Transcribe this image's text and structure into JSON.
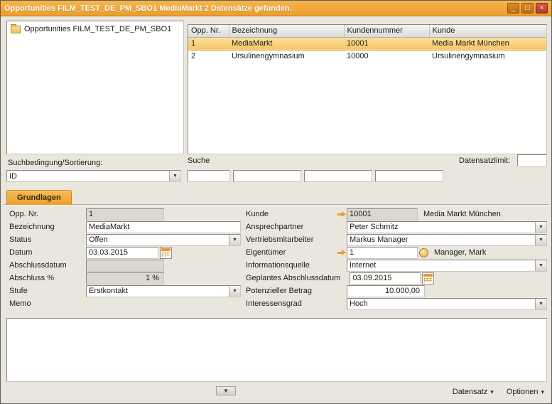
{
  "window": {
    "title": "Opportunities FILM_TEST_DE_PM_SBO1 MediaMarkt 2 Datensätze gefunden.",
    "controls": {
      "minimize": "_",
      "maximize": "□",
      "close": "×"
    }
  },
  "glyphs": {
    "combo_arrow": "▼",
    "chevron_down": "▾",
    "collapse_arrow": "▼"
  },
  "tree": {
    "root_label": "Opportunities FILM_TEST_DE_PM_SBO1"
  },
  "results_table": {
    "columns": [
      "Opp. Nr.",
      "Bezeichnung",
      "Kundennummer",
      "Kunde"
    ],
    "rows": [
      {
        "opp_nr": "1",
        "bezeichnung": "MediaMarkt",
        "kundennummer": "10001",
        "kunde": "Media Markt München"
      },
      {
        "opp_nr": "2",
        "bezeichnung": "Ursulinengymnasium",
        "kundennummer": "10000",
        "kunde": "Ursulinengymnasium"
      }
    ]
  },
  "search": {
    "sort_label": "Suchbedingung/Sortierung:",
    "sort_value": "ID",
    "search_label": "Suche",
    "limit_label": "Datensatzlimit:",
    "limit_value": "",
    "fields": [
      "",
      "",
      "",
      ""
    ]
  },
  "tab": {
    "label": "Grundlagen"
  },
  "form": {
    "opp_nr": {
      "label": "Opp. Nr.",
      "value": "1"
    },
    "bezeichnung": {
      "label": "Bezeichnung",
      "value": "MediaMarkt"
    },
    "status": {
      "label": "Status",
      "value": "Offen"
    },
    "datum": {
      "label": "Datum",
      "value": "03.03.2015"
    },
    "abschlussdatum": {
      "label": "Abschlussdatum",
      "value": ""
    },
    "abschluss_prozent": {
      "label": "Abschluss %",
      "value": "1 %"
    },
    "stufe": {
      "label": "Stufe",
      "value": "Erstkontakt"
    },
    "memo": {
      "label": "Memo",
      "value": ""
    },
    "kunde": {
      "label": "Kunde",
      "value": "10001",
      "text": "Media Markt München"
    },
    "ansprechpartner": {
      "label": "Ansprechpartner",
      "value": "Peter Schmitz"
    },
    "vertriebsmitarbeiter": {
      "label": "Vertriebsmitarbeiter",
      "value": "Markus Manager"
    },
    "eigentuemer": {
      "label": "Eigentümer",
      "value": "1",
      "text": "Manager, Mark"
    },
    "informationsquelle": {
      "label": "Informationsquelle",
      "value": "Internet"
    },
    "geplantes_abschlussdatum": {
      "label": "Geplantes Abschlussdatum",
      "value": "03.09.2015"
    },
    "potenzieller_betrag": {
      "label": "Potenzieller Betrag",
      "value": "10.000,00"
    },
    "interessensgrad": {
      "label": "Interessensgrad",
      "value": "Hoch"
    }
  },
  "footer": {
    "datensatz_label": "Datensatz",
    "optionen_label": "Optionen"
  },
  "colors": {
    "titlebar": "#f0a232",
    "selection": "#fad184",
    "tab": "#f2a93b"
  }
}
